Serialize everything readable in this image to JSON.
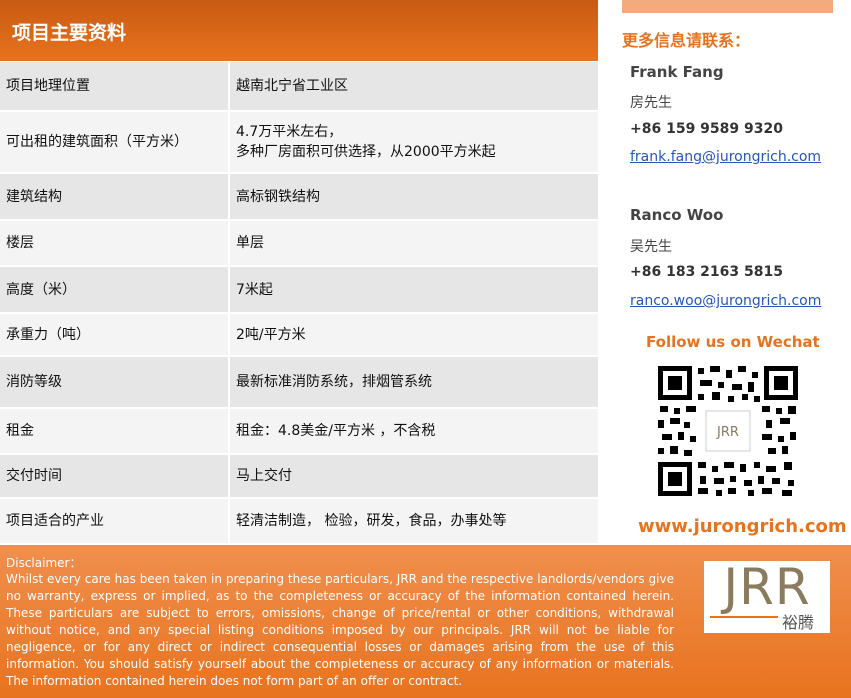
{
  "header": {
    "title": "项目主要资料"
  },
  "info_rows": [
    {
      "label": "项目地理位置",
      "value": "越南北宁省工业区"
    },
    {
      "label": "可出租的建筑面积（平方米）",
      "value": "4.7万平米左右，\n多种厂房面积可供选择，从2000平方米起"
    },
    {
      "label": "建筑结构",
      "value": "高标钢铁结构"
    },
    {
      "label": "楼层",
      "value": "单层"
    },
    {
      "label": "高度（米）",
      "value": "7米起"
    },
    {
      "label": "承重力（吨）",
      "value": "2吨/平方米"
    },
    {
      "label": "消防等级",
      "value": "最新标准消防系统，排烟管系统"
    },
    {
      "label": "租金",
      "value": "租金：4.8美金/平方米 ，不含税"
    },
    {
      "label": "交付时间",
      "value": "马上交付"
    },
    {
      "label": "项目适合的产业",
      "value": "轻清洁制造， 检验，研发，食品，办事处等"
    }
  ],
  "contact": {
    "title": "更多信息请联系：",
    "people": [
      {
        "name": "Frank Fang",
        "name_cn": "房先生",
        "phone": "+86 159 9589 9320",
        "email": "frank.fang@jurongrich.com"
      },
      {
        "name": "Ranco Woo",
        "name_cn": "吴先生",
        "phone": "+86 183 2163 5815",
        "email": "ranco.woo@jurongrich.com"
      }
    ],
    "follow": "Follow us on Wechat",
    "qr_icon": "qr-code-icon",
    "qr_logo": "JRR",
    "website": "www.jurongrich.com"
  },
  "disclaimer": {
    "label": "Disclaimer：",
    "text": "Whilst every care has been taken in preparing these particulars, JRR and the respective landlords/vendors give no warranty, express or implied, as to the completeness or accuracy of the information contained herein. These particulars are subject to errors, omissions, change of price/rental or other conditions, withdrawal without notice, and any special listing conditions imposed by our principals. JRR will not be liable for negligence, or for any direct or indirect consequential losses or damages arising from the use of this information. You should satisfy yourself about the completeness or accuracy of any information or materials. The information contained herein does not form part of an offer or contract."
  },
  "logo": {
    "text": "JRR",
    "cn": "裕腾"
  },
  "colors": {
    "accent": "#e8731e",
    "accent_dark": "#c85a12",
    "row_a": "#e6e6e6",
    "row_b": "#f4f4f4",
    "link": "#2556b8"
  }
}
